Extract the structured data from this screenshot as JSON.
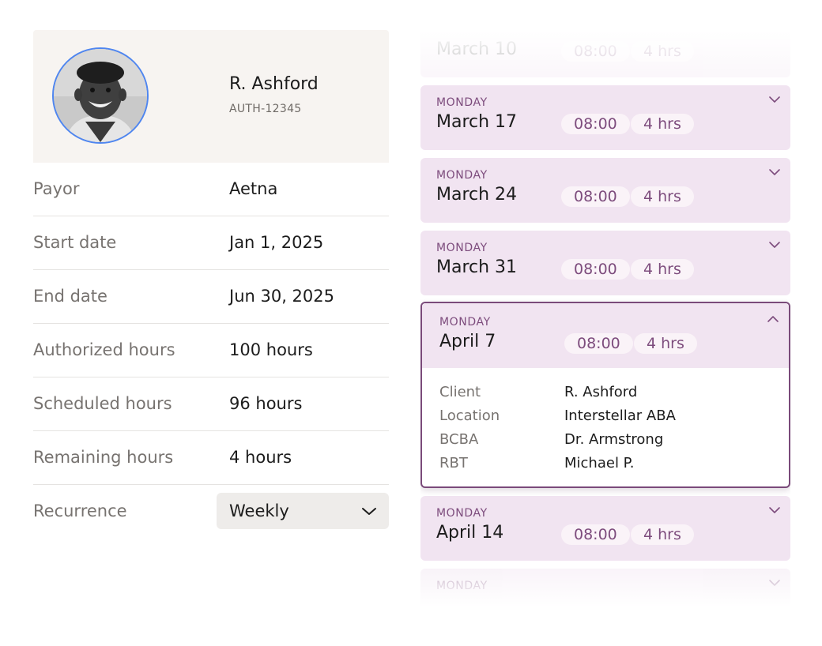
{
  "profile": {
    "name": "R. Ashford",
    "auth_id": "AUTH-12345"
  },
  "details": {
    "payor": {
      "label": "Payor",
      "value": "Aetna"
    },
    "start_date": {
      "label": "Start date",
      "value": "Jan 1, 2025"
    },
    "end_date": {
      "label": "End date",
      "value": "Jun 30, 2025"
    },
    "authorized_hours": {
      "label": "Authorized hours",
      "value": "100 hours"
    },
    "scheduled_hours": {
      "label": "Scheduled hours",
      "value": "96 hours"
    },
    "remaining_hours": {
      "label": "Remaining hours",
      "value": "4 hours"
    },
    "recurrence": {
      "label": "Recurrence",
      "value": "Weekly"
    }
  },
  "sessions": [
    {
      "day": "",
      "date": "March 10",
      "time": "08:00",
      "duration": "4 hrs"
    },
    {
      "day": "MONDAY",
      "date": "March 17",
      "time": "08:00",
      "duration": "4 hrs"
    },
    {
      "day": "MONDAY",
      "date": "March 24",
      "time": "08:00",
      "duration": "4 hrs"
    },
    {
      "day": "MONDAY",
      "date": "March 31",
      "time": "08:00",
      "duration": "4 hrs"
    },
    {
      "day": "MONDAY",
      "date": "April 7",
      "time": "08:00",
      "duration": "4 hrs",
      "details": {
        "client": {
          "label": "Client",
          "value": "R. Ashford"
        },
        "location": {
          "label": "Location",
          "value": "Interstellar ABA"
        },
        "bcba": {
          "label": "BCBA",
          "value": "Dr. Armstrong"
        },
        "rbt": {
          "label": "RBT",
          "value": "Michael P."
        }
      }
    },
    {
      "day": "MONDAY",
      "date": "April 14",
      "time": "08:00",
      "duration": "4 hrs"
    },
    {
      "day": "MONDAY",
      "date": "",
      "time": "",
      "duration": ""
    }
  ],
  "colors": {
    "accent": "#7d4c7d",
    "card_bg": "#f1e4f1",
    "avatar_ring": "#4f86f0"
  },
  "icons": {
    "collapsed": "chevron-down-icon",
    "expanded": "chevron-up-icon"
  }
}
